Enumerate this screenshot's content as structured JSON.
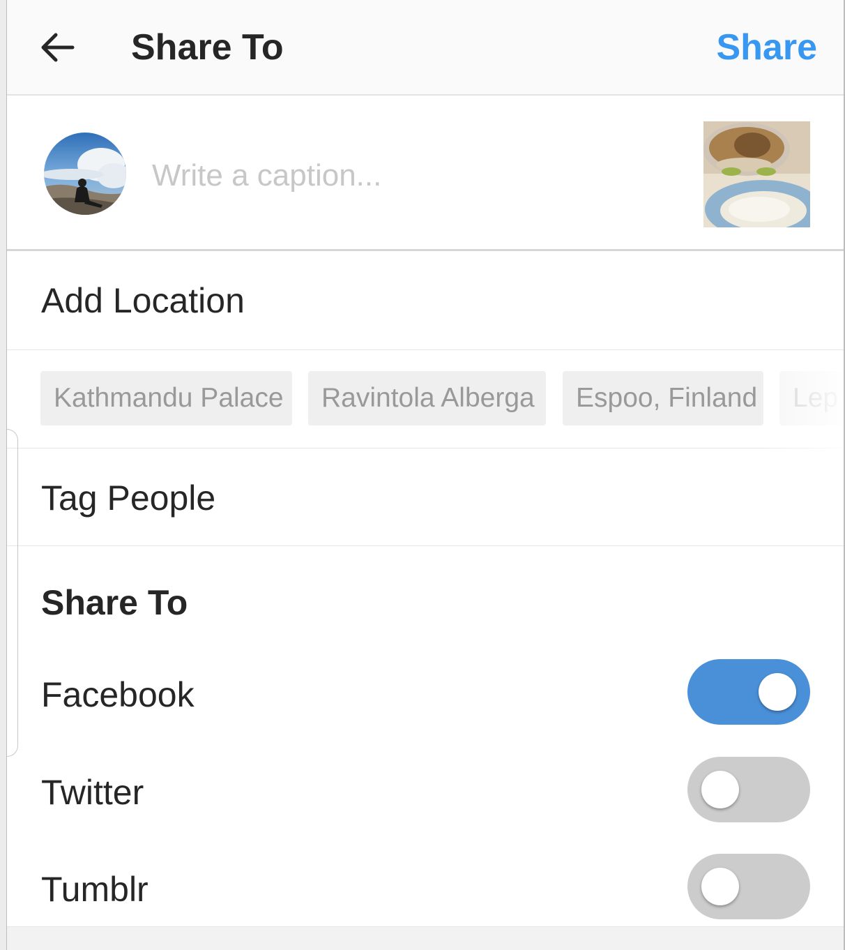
{
  "header": {
    "back_icon": "arrow-left-icon",
    "title": "Share To",
    "share_label": "Share",
    "accent_color": "#3897f0"
  },
  "caption": {
    "avatar": "profile-photo-mountain",
    "placeholder": "Write a caption...",
    "value": "",
    "thumbnail": "food-photo-soup-and-rice"
  },
  "location": {
    "label": "Add Location",
    "suggestions": [
      "Kathmandu Palace",
      "Ravintola Alberga",
      "Espoo, Finland",
      "Lep"
    ]
  },
  "tag_people": {
    "label": "Tag People"
  },
  "share_to": {
    "heading": "Share To",
    "items": [
      {
        "label": "Facebook",
        "enabled": true
      },
      {
        "label": "Twitter",
        "enabled": false
      },
      {
        "label": "Tumblr",
        "enabled": false
      }
    ],
    "toggle_on_color": "#4a90d9",
    "toggle_off_color": "#cccccc"
  }
}
